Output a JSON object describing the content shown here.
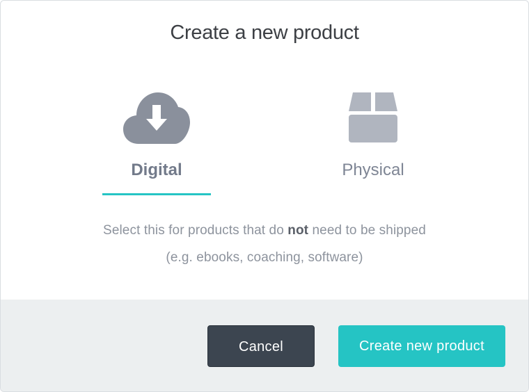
{
  "dialog": {
    "title": "Create a new product"
  },
  "options": {
    "digital": {
      "label": "Digital",
      "icon": "cloud-download-icon",
      "selected": true
    },
    "physical": {
      "label": "Physical",
      "icon": "box-icon",
      "selected": false
    }
  },
  "description": {
    "line1_before": "Select this for products that do ",
    "line1_bold": "not",
    "line1_after": " need to be shipped",
    "line2": "(e.g. ebooks, coaching, software)"
  },
  "footer": {
    "cancel_label": "Cancel",
    "create_label": "Create new product"
  },
  "colors": {
    "accent": "#25c4c4",
    "cancel_bg": "#3c4550",
    "icon_digital": "#8a909c",
    "icon_physical": "#b0b5bf",
    "footer_bg": "#eceff0"
  }
}
